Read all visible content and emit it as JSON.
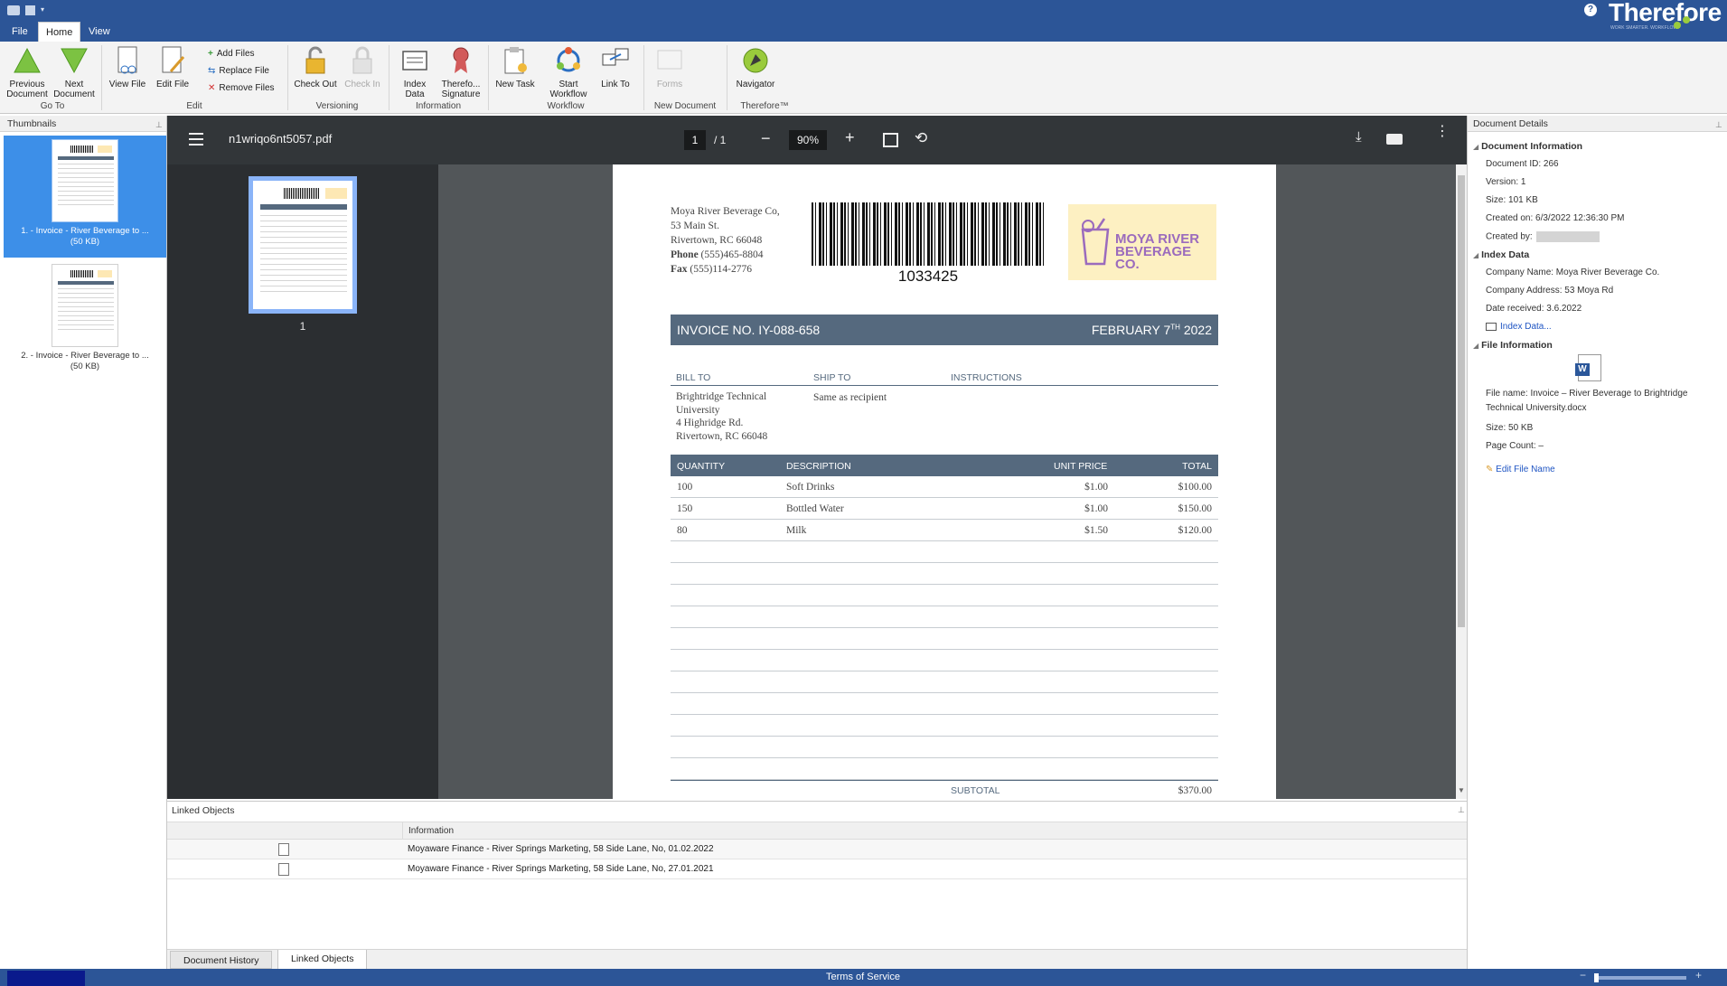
{
  "tabs": {
    "file": "File",
    "home": "Home",
    "view": "View"
  },
  "logo": {
    "text": "Therefore",
    "tagline": "WORK SMARTER. WORKFLOW."
  },
  "ribbon": {
    "prev_doc": "Previous\nDocument",
    "next_doc": "Next\nDocument",
    "view_file": "View File",
    "edit_file": "Edit File",
    "add_files": "Add Files",
    "replace_file": "Replace File",
    "remove_files": "Remove Files",
    "check_out": "Check Out",
    "check_in": "Check In",
    "index_data": "Index\nData",
    "therefore_signature": "Therefo...\nSignature",
    "new_task": "New Task",
    "start_workflow": "Start\nWorkflow",
    "link_to": "Link To",
    "forms": "Forms",
    "navigator": "Navigator",
    "groups": {
      "goto": "Go To",
      "edit": "Edit",
      "versioning": "Versioning",
      "information": "Information",
      "workflow": "Workflow",
      "new_document": "New Document",
      "therefore": "Therefore™"
    }
  },
  "thumbnails": {
    "title": "Thumbnails",
    "items": [
      {
        "label": "1. - Invoice - River Beverage to ...",
        "size": "(50 KB)"
      },
      {
        "label": "2. - Invoice - River Beverage to ...",
        "size": "(50 KB)"
      }
    ]
  },
  "viewer": {
    "filename": "n1wriqo6nt5057.pdf",
    "page": "1",
    "total": "/  1",
    "zoom": "90%",
    "sidebar_page": "1"
  },
  "invoice": {
    "from": {
      "name": "Moya River Beverage Co,",
      "street": "53 Main St.",
      "city": "Rivertown, RC 66048",
      "phone_label": "Phone",
      "phone": "(555)465-8804",
      "fax_label": "Fax",
      "fax": "(555)114-2776"
    },
    "barcode": "1033425",
    "logo": "MOYA RIVER\nBEVERAGE CO.",
    "number": "INVOICE NO. IY-088-658",
    "date_pre": "FEBRUARY 7",
    "date_sup": "TH",
    "date_post": " 2022",
    "bill_to_label": "BILL TO",
    "ship_to_label": "SHIP TO",
    "instructions_label": "INSTRUCTIONS",
    "bill_to": [
      "Brightridge Technical",
      "University",
      "4 Highridge Rd.",
      "Rivertown, RC 66048"
    ],
    "ship_to": "Same as recipient",
    "cols": {
      "qty": "QUANTITY",
      "desc": "DESCRIPTION",
      "unit": "UNIT PRICE",
      "total": "TOTAL"
    },
    "rows": [
      {
        "qty": "100",
        "desc": "Soft Drinks",
        "unit": "$1.00",
        "total": "$100.00"
      },
      {
        "qty": "150",
        "desc": "Bottled Water",
        "unit": "$1.00",
        "total": "$150.00"
      },
      {
        "qty": "80",
        "desc": "Milk",
        "unit": "$1.50",
        "total": "$120.00"
      }
    ],
    "subtotal_label": "SUBTOTAL",
    "subtotal": "$370.00"
  },
  "details": {
    "title": "Document Details",
    "doc_info": "Document Information",
    "doc_id": "Document ID: 266",
    "version": "Version: 1",
    "size": "Size: 101 KB",
    "created_on": "Created on: 6/3/2022 12:36:30 PM",
    "created_by": "Created by:",
    "index_data": "Index Data",
    "company_name": "Company Name: Moya River Beverage Co.",
    "company_address": "Company Address: 53 Moya Rd",
    "date_received": "Date received: 3.6.2022",
    "index_link": "Index Data...",
    "file_info": "File Information",
    "file_name_1": "File name: Invoice – River Beverage to Brightridge",
    "file_name_2": "Technical University.docx",
    "file_size": "Size: 50 KB",
    "page_count": "Page Count: –",
    "edit_file_name": "Edit File Name"
  },
  "linked": {
    "title": "Linked Objects",
    "col": "Information",
    "rows": [
      "Moyaware Finance - River Springs Marketing, 58 Side Lane, No, 01.02.2022",
      "Moyaware Finance - River Springs Marketing, 58 Side Lane, No, 27.01.2021"
    ],
    "tab_history": "Document History",
    "tab_linked": "Linked Objects"
  },
  "status": {
    "terms": "Terms of Service"
  },
  "colors": {
    "brand": "#2c5597",
    "invoice_header": "#55697e",
    "selected": "#3d8fe8"
  }
}
